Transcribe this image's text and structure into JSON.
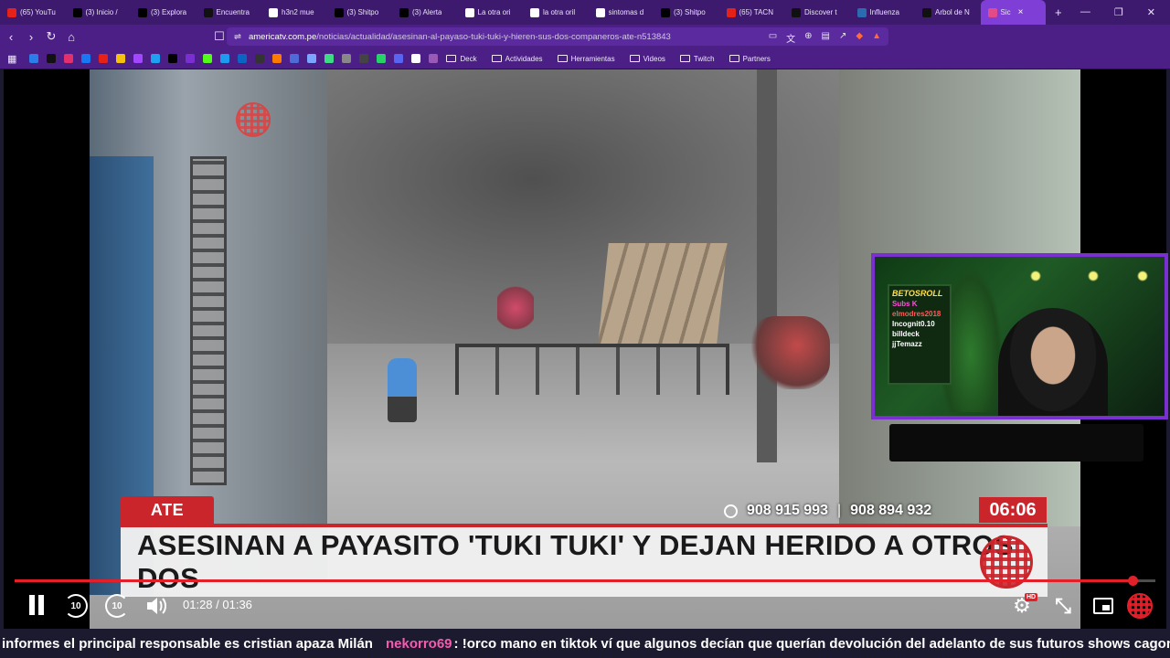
{
  "tabs": [
    {
      "label": "(65) YouTu",
      "icon": "youtube-icon",
      "color": "#e62117"
    },
    {
      "label": "(3) Inicio /",
      "icon": "x-icon",
      "color": "#000000"
    },
    {
      "label": "(3) Explora",
      "icon": "x-icon",
      "color": "#000000"
    },
    {
      "label": "Encuentra",
      "icon": "tiktok-icon",
      "color": "#111111"
    },
    {
      "label": "h3n2 mue",
      "icon": "google-icon",
      "color": "#ffffff"
    },
    {
      "label": "(3) Shitpo",
      "icon": "x-icon",
      "color": "#000000"
    },
    {
      "label": "(3) Alerta",
      "icon": "x-icon",
      "color": "#000000"
    },
    {
      "label": "La otra ori",
      "icon": "wikipedia-icon",
      "color": "#ffffff"
    },
    {
      "label": "la otra oril",
      "icon": "google-icon",
      "color": "#ffffff"
    },
    {
      "label": "sintomas d",
      "icon": "google-icon",
      "color": "#ffffff"
    },
    {
      "label": "(3) Shitpo",
      "icon": "x-icon",
      "color": "#000000"
    },
    {
      "label": "(65) TACN",
      "icon": "youtube-icon",
      "color": "#e62117"
    },
    {
      "label": "Discover t",
      "icon": "tiktok-icon",
      "color": "#111111"
    },
    {
      "label": "Influenza",
      "icon": "n-icon",
      "color": "#2b6cb0"
    },
    {
      "label": "Arbol de N",
      "icon": "tiktok-icon",
      "color": "#111111"
    },
    {
      "label": "Sic",
      "icon": "site-icon",
      "color": "#e24a8a",
      "active": true
    }
  ],
  "tab_close": "×",
  "new_tab": "+",
  "window_controls": [
    "—",
    "❐",
    "✕"
  ],
  "address": {
    "host": "americatv.com.pe",
    "path": "/noticias/actualidad/asesinan-al-payaso-tuki-tuki-y-hieren-sus-dos-companeros-ate-n513843"
  },
  "bookmarks": {
    "folders": [
      "Deck",
      "Actividades",
      "Herramientas",
      "Videos",
      "Twitch",
      "Partners"
    ]
  },
  "video": {
    "tag": "ATE",
    "phones": [
      "908 915 993",
      "|",
      "908 894 932"
    ],
    "clock": "06:06",
    "headline": "ASESINAN A PAYASITO 'TUKI TUKI' Y DEJAN HERIDO A OTROS DOS",
    "progress": 0.98,
    "time": "01:28 / 01:36",
    "skip_back": "10",
    "skip_forward": "10",
    "hd_badge": "HD"
  },
  "webcam": {
    "overlay_lines": [
      "BETOSROLL",
      "Subs K",
      "elmodres2018",
      "Incognit0.10",
      "billdeck",
      "jjTemazz",
      ""
    ]
  },
  "chat": {
    "tail_message": "informes el principal responsable es cristian apaza Milán",
    "username": "nekorro69",
    "message": ": !orco mano en tiktok ví que algunos decían que querían devolución del adelanto de sus futuros shows cagonazos"
  },
  "colors": {
    "accent": "#7a2fd1",
    "brand_red": "#c9252b",
    "progress_red": "#e3202a",
    "chat_user": "#f45cb0"
  }
}
